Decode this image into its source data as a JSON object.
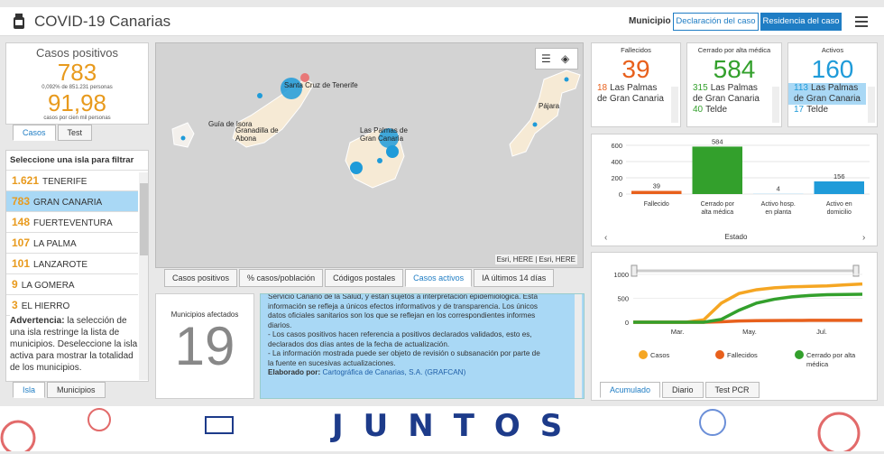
{
  "header": {
    "title": "COVID-19 Canarias",
    "municipio_label": "Municipio",
    "btn_declaracion": "Declaración del caso",
    "btn_residencia": "Residencia del caso"
  },
  "casos": {
    "title": "Casos positivos",
    "value": "783",
    "pct_text": "0,092% de 851.231 personas",
    "rate": "91,98",
    "rate_text": "casos por cien mil personas",
    "tabs": [
      "Casos",
      "Test"
    ]
  },
  "islands": {
    "heading": "Seleccione una isla para filtrar",
    "items": [
      {
        "n": "1.621",
        "name": "TENERIFE"
      },
      {
        "n": "783",
        "name": "GRAN CANARIA"
      },
      {
        "n": "148",
        "name": "FUERTEVENTURA"
      },
      {
        "n": "107",
        "name": "LA PALMA"
      },
      {
        "n": "101",
        "name": "LANZAROTE"
      },
      {
        "n": "9",
        "name": "LA GOMERA"
      },
      {
        "n": "3",
        "name": "EL HIERRO"
      }
    ],
    "advert_bold": "Advertencia:",
    "advert": " la selección de una isla restringe la lista de municipios. Deseleccione la isla activa para mostrar la totalidad de los municipios.",
    "tabs": [
      "Isla",
      "Municipios"
    ]
  },
  "map": {
    "labels": [
      "Santa Cruz de Tenerife",
      "Guía de Isora",
      "Granadilla de Abona",
      "Las Palmas de Gran Canaria",
      "Pájara"
    ],
    "attribution": "Esri, HERE | Esri, HERE",
    "tabs": [
      "Casos positivos",
      "% casos/población",
      "Códigos postales",
      "Casos activos",
      "IA últimos 14 días"
    ]
  },
  "municipios": {
    "title": "Municipios afectados",
    "value": "19"
  },
  "info": {
    "lines": [
      "Servicio Canario de la Salud, y están sujetos a interpretación epidemiológica. Esta",
      "información se refleja a únicos efectos informativos y de transparencia. Los únicos",
      "datos oficiales sanitarios son los que se reflejan en los correspondientes informes",
      "diarios.",
      "- Los casos positivos hacen referencia a positivos declarados validados, esto es,",
      "declarados dos días antes de la fecha de actualización.",
      "- La información mostrada puede ser objeto de revisión o subsanación por parte de",
      "la fuente en sucesivas actualizaciones."
    ],
    "elaborado_label": "Elaborado por:",
    "elaborado_value": " Cartográfica de Canarias, S.A. (GRAFCAN)"
  },
  "cards": {
    "fallecidos": {
      "title": "Fallecidos",
      "value": "39",
      "color": "#e8601c",
      "rows": [
        {
          "n": "18",
          "name": "Las Palmas de Gran Canaria"
        }
      ]
    },
    "cerrado": {
      "title": "Cerrado por alta médica",
      "value": "584",
      "color": "#33a02c",
      "rows": [
        {
          "n": "315",
          "name": "Las Palmas de Gran Canaria"
        },
        {
          "n": "40",
          "name": "Telde"
        }
      ]
    },
    "activos": {
      "title": "Activos",
      "value": "160",
      "color": "#1f9bd9",
      "rows": [
        {
          "n": "113",
          "name": "Las Palmas de Gran Canaria"
        },
        {
          "n": "17",
          "name": "Telde"
        }
      ]
    }
  },
  "chart_data": [
    {
      "type": "bar",
      "categories": [
        "Fallecido",
        "Cerrado por alta médica",
        "Activo hosp. en planta",
        "Activo en domicilio"
      ],
      "values": [
        39,
        584,
        4,
        156
      ],
      "colors": [
        "#e8601c",
        "#33a02c",
        "#a9d8f5",
        "#1f9bd9"
      ],
      "xlabel": "Estado",
      "ylim": [
        0,
        600
      ],
      "yticks": [
        0,
        200,
        400,
        600
      ]
    },
    {
      "type": "line",
      "x_ticks": [
        "Mar.",
        "May.",
        "Jul."
      ],
      "ylim": [
        0,
        1000
      ],
      "yticks": [
        0,
        500,
        1000
      ],
      "series": [
        {
          "name": "Casos",
          "color": "#f5a623",
          "values": [
            0,
            0,
            0,
            0,
            50,
            400,
            600,
            680,
            720,
            740,
            750,
            760,
            780,
            800
          ]
        },
        {
          "name": "Fallecidos",
          "color": "#e8601c",
          "values": [
            0,
            0,
            0,
            0,
            0,
            10,
            25,
            33,
            36,
            38,
            39,
            39,
            39,
            39
          ]
        },
        {
          "name": "Cerrado por alta médica",
          "color": "#33a02c",
          "values": [
            0,
            0,
            0,
            0,
            0,
            60,
            250,
            400,
            480,
            530,
            560,
            575,
            580,
            584
          ]
        }
      ],
      "tabs": [
        "Acumulado",
        "Diario",
        "Test PCR"
      ]
    }
  ],
  "banner": {
    "text": "JUNTOS"
  }
}
